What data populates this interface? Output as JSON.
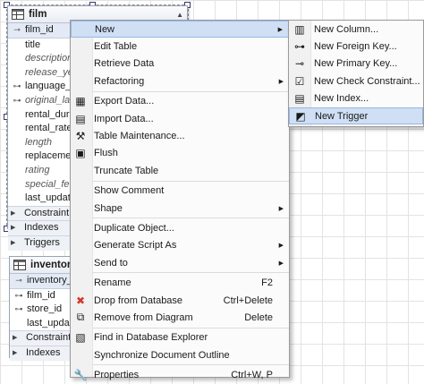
{
  "film": {
    "title": "film",
    "pk_rows": [
      {
        "name": "film_id",
        "key": "pk"
      }
    ],
    "rows": [
      {
        "name": "title",
        "key": "",
        "italic": false
      },
      {
        "name": "description",
        "key": "",
        "italic": true
      },
      {
        "name": "release_ye",
        "key": "",
        "italic": true
      },
      {
        "name": "language_",
        "key": "fk",
        "italic": false
      },
      {
        "name": "original_la",
        "key": "fk",
        "italic": true
      },
      {
        "name": "rental_dur",
        "key": "",
        "italic": false
      },
      {
        "name": "rental_rate",
        "key": "",
        "italic": false
      },
      {
        "name": "length",
        "key": "",
        "italic": true
      },
      {
        "name": "replaceme",
        "key": "",
        "italic": false
      },
      {
        "name": "rating",
        "key": "",
        "italic": true
      },
      {
        "name": "special_fe",
        "key": "",
        "italic": true
      },
      {
        "name": "last_updat",
        "key": "",
        "italic": false
      }
    ],
    "sections": [
      "Constraint",
      "Indexes",
      "Triggers"
    ]
  },
  "inventory": {
    "title": "inventory",
    "pk_rows": [
      {
        "name": "inventory_",
        "key": "pk"
      }
    ],
    "rows": [
      {
        "name": "film_id",
        "key": "fk",
        "italic": false
      },
      {
        "name": "store_id",
        "key": "fk",
        "italic": false
      },
      {
        "name": "last_updat",
        "key": "",
        "italic": false
      }
    ],
    "sections": [
      "Constraint",
      "Indexes"
    ]
  },
  "context_menu": {
    "items": [
      {
        "label": "New",
        "icon": "",
        "shortcut": "",
        "submenu": true,
        "highlight": true,
        "sep_after": false
      },
      {
        "label": "Edit Table",
        "icon": "",
        "shortcut": "",
        "submenu": false,
        "sep_after": false
      },
      {
        "label": "Retrieve Data",
        "icon": "",
        "shortcut": "",
        "submenu": false,
        "sep_after": false
      },
      {
        "label": "Refactoring",
        "icon": "",
        "shortcut": "",
        "submenu": true,
        "sep_after": true
      },
      {
        "label": "Export Data...",
        "icon": "export-data-icon",
        "shortcut": "",
        "submenu": false,
        "sep_after": false
      },
      {
        "label": "Import Data...",
        "icon": "import-data-icon",
        "shortcut": "",
        "submenu": false,
        "sep_after": false
      },
      {
        "label": "Table Maintenance...",
        "icon": "tools-icon",
        "shortcut": "",
        "submenu": false,
        "sep_after": false
      },
      {
        "label": "Flush",
        "icon": "flush-icon",
        "shortcut": "",
        "submenu": false,
        "sep_after": false
      },
      {
        "label": "Truncate Table",
        "icon": "",
        "shortcut": "",
        "submenu": false,
        "sep_after": true
      },
      {
        "label": "Show Comment",
        "icon": "",
        "shortcut": "",
        "submenu": false,
        "sep_after": false
      },
      {
        "label": "Shape",
        "icon": "",
        "shortcut": "",
        "submenu": true,
        "sep_after": true
      },
      {
        "label": "Duplicate Object...",
        "icon": "",
        "shortcut": "",
        "submenu": false,
        "sep_after": false
      },
      {
        "label": "Generate Script As",
        "icon": "",
        "shortcut": "",
        "submenu": true,
        "sep_after": false
      },
      {
        "label": "Send to",
        "icon": "",
        "shortcut": "",
        "submenu": true,
        "sep_after": true
      },
      {
        "label": "Rename",
        "icon": "",
        "shortcut": "F2",
        "submenu": false,
        "sep_after": false
      },
      {
        "label": "Drop from Database",
        "icon": "drop-red-x-icon",
        "shortcut": "Ctrl+Delete",
        "submenu": false,
        "sep_after": false
      },
      {
        "label": "Remove from Diagram",
        "icon": "remove-diagram-icon",
        "shortcut": "Delete",
        "submenu": false,
        "sep_after": true
      },
      {
        "label": "Find in Database Explorer",
        "icon": "find-explorer-icon",
        "shortcut": "",
        "submenu": false,
        "sep_after": false
      },
      {
        "label": "Synchronize Document Outline",
        "icon": "",
        "shortcut": "",
        "submenu": false,
        "sep_after": true
      },
      {
        "label": "Properties",
        "icon": "wrench-icon",
        "shortcut": "Ctrl+W, P",
        "submenu": false,
        "sep_after": false
      }
    ]
  },
  "submenu": {
    "items": [
      {
        "label": "New Column...",
        "icon": "new-column-icon",
        "highlight": false
      },
      {
        "label": "New Foreign Key...",
        "icon": "foreign-key-icon",
        "highlight": false
      },
      {
        "label": "New Primary Key...",
        "icon": "primary-key-icon",
        "highlight": false
      },
      {
        "label": "New Check Constraint...",
        "icon": "check-constraint-icon",
        "highlight": false
      },
      {
        "label": "New Index...",
        "icon": "index-icon",
        "highlight": false
      },
      {
        "label": "New Trigger",
        "icon": "trigger-icon",
        "highlight": true
      }
    ]
  },
  "colors": {
    "highlight": "#cfdff4",
    "highlight_border": "#98b7e3",
    "drop_red": "#d23b2a"
  }
}
